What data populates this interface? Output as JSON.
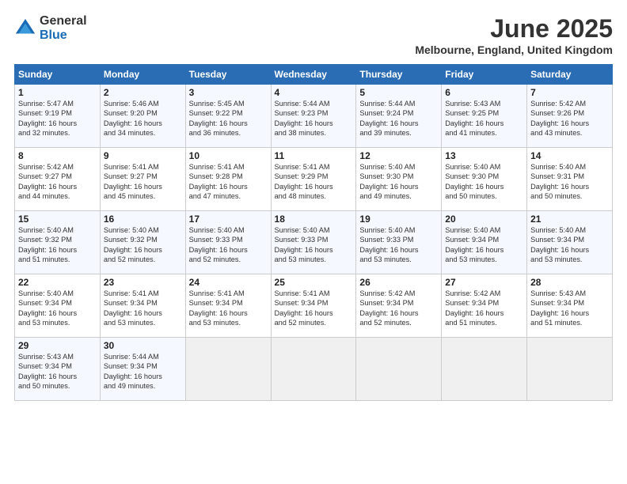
{
  "logo": {
    "general": "General",
    "blue": "Blue"
  },
  "title": "June 2025",
  "location": "Melbourne, England, United Kingdom",
  "days_header": [
    "Sunday",
    "Monday",
    "Tuesday",
    "Wednesday",
    "Thursday",
    "Friday",
    "Saturday"
  ],
  "weeks": [
    [
      {
        "day": "1",
        "sunrise": "5:47 AM",
        "sunset": "9:19 PM",
        "daylight": "16 hours and 32 minutes."
      },
      {
        "day": "2",
        "sunrise": "5:46 AM",
        "sunset": "9:20 PM",
        "daylight": "16 hours and 34 minutes."
      },
      {
        "day": "3",
        "sunrise": "5:45 AM",
        "sunset": "9:22 PM",
        "daylight": "16 hours and 36 minutes."
      },
      {
        "day": "4",
        "sunrise": "5:44 AM",
        "sunset": "9:23 PM",
        "daylight": "16 hours and 38 minutes."
      },
      {
        "day": "5",
        "sunrise": "5:44 AM",
        "sunset": "9:24 PM",
        "daylight": "16 hours and 39 minutes."
      },
      {
        "day": "6",
        "sunrise": "5:43 AM",
        "sunset": "9:25 PM",
        "daylight": "16 hours and 41 minutes."
      },
      {
        "day": "7",
        "sunrise": "5:42 AM",
        "sunset": "9:26 PM",
        "daylight": "16 hours and 43 minutes."
      }
    ],
    [
      {
        "day": "8",
        "sunrise": "5:42 AM",
        "sunset": "9:27 PM",
        "daylight": "16 hours and 44 minutes."
      },
      {
        "day": "9",
        "sunrise": "5:41 AM",
        "sunset": "9:27 PM",
        "daylight": "16 hours and 45 minutes."
      },
      {
        "day": "10",
        "sunrise": "5:41 AM",
        "sunset": "9:28 PM",
        "daylight": "16 hours and 47 minutes."
      },
      {
        "day": "11",
        "sunrise": "5:41 AM",
        "sunset": "9:29 PM",
        "daylight": "16 hours and 48 minutes."
      },
      {
        "day": "12",
        "sunrise": "5:40 AM",
        "sunset": "9:30 PM",
        "daylight": "16 hours and 49 minutes."
      },
      {
        "day": "13",
        "sunrise": "5:40 AM",
        "sunset": "9:30 PM",
        "daylight": "16 hours and 50 minutes."
      },
      {
        "day": "14",
        "sunrise": "5:40 AM",
        "sunset": "9:31 PM",
        "daylight": "16 hours and 50 minutes."
      }
    ],
    [
      {
        "day": "15",
        "sunrise": "5:40 AM",
        "sunset": "9:32 PM",
        "daylight": "16 hours and 51 minutes."
      },
      {
        "day": "16",
        "sunrise": "5:40 AM",
        "sunset": "9:32 PM",
        "daylight": "16 hours and 52 minutes."
      },
      {
        "day": "17",
        "sunrise": "5:40 AM",
        "sunset": "9:33 PM",
        "daylight": "16 hours and 52 minutes."
      },
      {
        "day": "18",
        "sunrise": "5:40 AM",
        "sunset": "9:33 PM",
        "daylight": "16 hours and 53 minutes."
      },
      {
        "day": "19",
        "sunrise": "5:40 AM",
        "sunset": "9:33 PM",
        "daylight": "16 hours and 53 minutes."
      },
      {
        "day": "20",
        "sunrise": "5:40 AM",
        "sunset": "9:34 PM",
        "daylight": "16 hours and 53 minutes."
      },
      {
        "day": "21",
        "sunrise": "5:40 AM",
        "sunset": "9:34 PM",
        "daylight": "16 hours and 53 minutes."
      }
    ],
    [
      {
        "day": "22",
        "sunrise": "5:40 AM",
        "sunset": "9:34 PM",
        "daylight": "16 hours and 53 minutes."
      },
      {
        "day": "23",
        "sunrise": "5:41 AM",
        "sunset": "9:34 PM",
        "daylight": "16 hours and 53 minutes."
      },
      {
        "day": "24",
        "sunrise": "5:41 AM",
        "sunset": "9:34 PM",
        "daylight": "16 hours and 53 minutes."
      },
      {
        "day": "25",
        "sunrise": "5:41 AM",
        "sunset": "9:34 PM",
        "daylight": "16 hours and 52 minutes."
      },
      {
        "day": "26",
        "sunrise": "5:42 AM",
        "sunset": "9:34 PM",
        "daylight": "16 hours and 52 minutes."
      },
      {
        "day": "27",
        "sunrise": "5:42 AM",
        "sunset": "9:34 PM",
        "daylight": "16 hours and 51 minutes."
      },
      {
        "day": "28",
        "sunrise": "5:43 AM",
        "sunset": "9:34 PM",
        "daylight": "16 hours and 51 minutes."
      }
    ],
    [
      {
        "day": "29",
        "sunrise": "5:43 AM",
        "sunset": "9:34 PM",
        "daylight": "16 hours and 50 minutes."
      },
      {
        "day": "30",
        "sunrise": "5:44 AM",
        "sunset": "9:34 PM",
        "daylight": "16 hours and 49 minutes."
      },
      null,
      null,
      null,
      null,
      null
    ]
  ]
}
